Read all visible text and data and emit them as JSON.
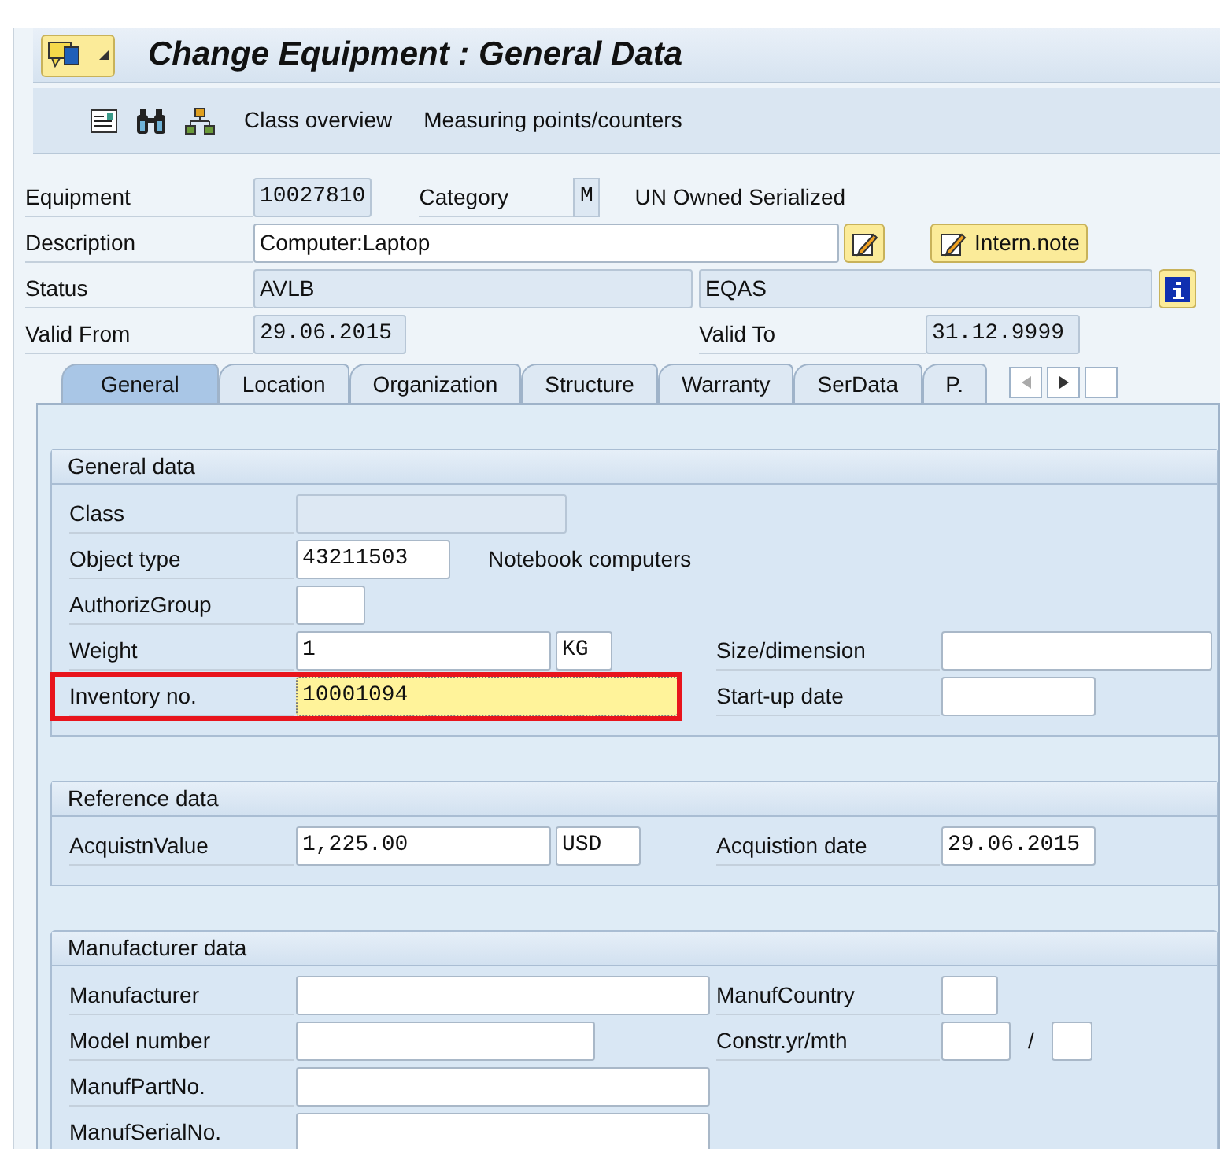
{
  "title_bar": {
    "title": "Change Equipment : General Data"
  },
  "toolbar": {
    "buttons": [
      "Class overview",
      "Measuring points/counters"
    ]
  },
  "header": {
    "equipment": {
      "label": "Equipment",
      "value": "10027810"
    },
    "category": {
      "label": "Category",
      "value": "M",
      "text": "UN Owned Serialized"
    },
    "description": {
      "label": "Description",
      "value": "Computer:Laptop",
      "note_button": "Intern.note"
    },
    "status": {
      "label": "Status",
      "values": [
        "AVLB",
        "EQAS"
      ]
    },
    "valid_from": {
      "label": "Valid From",
      "value": "29.06.2015"
    },
    "valid_to": {
      "label": "Valid To",
      "value": "31.12.9999"
    }
  },
  "tabs": [
    {
      "label": "General",
      "selected": true
    },
    {
      "label": "Location",
      "selected": false
    },
    {
      "label": "Organization",
      "selected": false
    },
    {
      "label": "Structure",
      "selected": false
    },
    {
      "label": "Warranty",
      "selected": false
    },
    {
      "label": "SerData",
      "selected": false
    },
    {
      "label": "P.",
      "selected": false
    }
  ],
  "groups": [
    {
      "title": "General data",
      "rows": [
        {
          "highlighted": false,
          "left": {
            "label": "Class",
            "fields": [
              {
                "kind": "display"
              }
            ]
          }
        },
        {
          "highlighted": false,
          "left": {
            "label": "Object type",
            "fields": [
              {
                "kind": "input",
                "value": "43211503"
              }
            ],
            "text": "Notebook computers"
          }
        },
        {
          "highlighted": false,
          "left": {
            "label": "AuthorizGroup",
            "fields": [
              {
                "kind": "input"
              }
            ]
          }
        },
        {
          "highlighted": false,
          "left": {
            "label": "Weight",
            "fields": [
              {
                "kind": "input",
                "value": "1"
              },
              {
                "kind": "input",
                "value": "KG"
              }
            ]
          },
          "right": {
            "label": "Size/dimension",
            "fields": [
              {
                "kind": "input"
              }
            ]
          }
        },
        {
          "highlighted": true,
          "left": {
            "label": "Inventory no.",
            "fields": [
              {
                "kind": "focused",
                "value": "10001094"
              }
            ]
          },
          "right": {
            "label": "Start-up date",
            "fields": [
              {
                "kind": "input"
              }
            ]
          }
        }
      ]
    },
    {
      "title": "Reference data",
      "rows": [
        {
          "highlighted": false,
          "left": {
            "label": "AcquistnValue",
            "fields": [
              {
                "kind": "input",
                "value": "1,225.00"
              },
              {
                "kind": "input",
                "value": "USD"
              }
            ]
          },
          "right": {
            "label": "Acquistion date",
            "fields": [
              {
                "kind": "input",
                "value": "29.06.2015"
              }
            ]
          }
        }
      ]
    },
    {
      "title": "Manufacturer data",
      "rows": [
        {
          "highlighted": false,
          "left": {
            "label": "Manufacturer",
            "fields": [
              {
                "kind": "input"
              }
            ]
          },
          "right": {
            "label": "ManufCountry",
            "fields": [
              {
                "kind": "input"
              }
            ]
          }
        },
        {
          "highlighted": false,
          "left": {
            "label": "Model number",
            "fields": [
              {
                "kind": "input"
              }
            ]
          },
          "right": {
            "label": "Constr.yr/mth",
            "fields": [
              {
                "kind": "input"
              },
              {
                "kind": "separator",
                "text": "/"
              },
              {
                "kind": "input"
              }
            ]
          }
        },
        {
          "highlighted": false,
          "left": {
            "label": "ManufPartNo.",
            "fields": [
              {
                "kind": "input"
              }
            ]
          }
        },
        {
          "highlighted": false,
          "left": {
            "label": "ManufSerialNo.",
            "fields": [
              {
                "kind": "input"
              }
            ]
          }
        }
      ]
    }
  ]
}
